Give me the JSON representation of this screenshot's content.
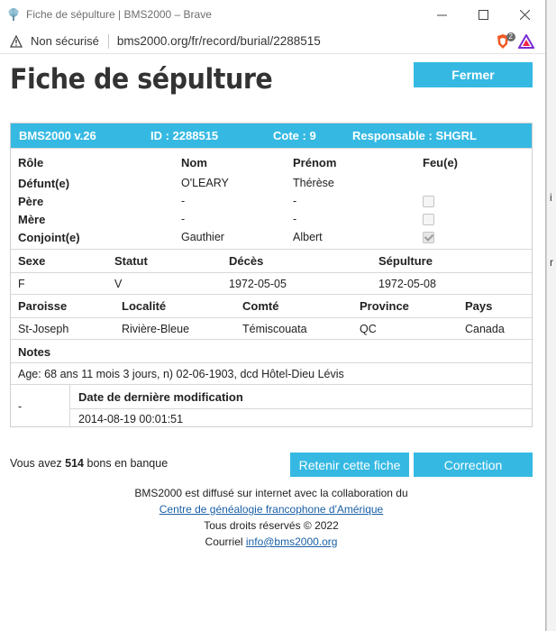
{
  "window": {
    "title": "Fiche de sépulture | BMS2000 – Brave",
    "minimize": "—",
    "maximize": "☐",
    "close": "✕"
  },
  "address": {
    "security": "Non sécurisé",
    "url": "bms2000.org/fr/record/burial/2288515",
    "shield_badge": "2"
  },
  "page": {
    "title": "Fiche de sépulture",
    "close_button": "Fermer"
  },
  "record": {
    "version": "BMS2000 v.26",
    "id": "ID : 2288515",
    "cote": "Cote : 9",
    "responsable": "Responsable : SHGRL",
    "persons_headers": {
      "role": "Rôle",
      "nom": "Nom",
      "prenom": "Prénom",
      "feu": "Feu(e)"
    },
    "persons": [
      {
        "role": "Défunt(e)",
        "nom": "O'LEARY",
        "prenom": "Thérèse",
        "feu": null
      },
      {
        "role": "Père",
        "nom": "-",
        "prenom": "-",
        "feu": false
      },
      {
        "role": "Mère",
        "nom": "-",
        "prenom": "-",
        "feu": false
      },
      {
        "role": "Conjoint(e)",
        "nom": "Gauthier",
        "prenom": "Albert",
        "feu": true
      }
    ],
    "vital_headers": {
      "sexe": "Sexe",
      "statut": "Statut",
      "deces": "Décès",
      "sepulture": "Sépulture"
    },
    "vital": {
      "sexe": "F",
      "statut": "V",
      "deces": "1972-05-05",
      "sepulture": "1972-05-08"
    },
    "place_headers": {
      "paroisse": "Paroisse",
      "localite": "Localité",
      "comte": "Comté",
      "province": "Province",
      "pays": "Pays"
    },
    "place": {
      "paroisse": "St-Joseph",
      "localite": "Rivière-Bleue",
      "comte": "Témiscouata",
      "province": "QC",
      "pays": "Canada"
    },
    "notes_header": "Notes",
    "notes": "Age: 68 ans 11 mois 3 jours, n) 02-06-1903, dcd Hôtel-Dieu Lévis",
    "modif_left": "-",
    "modif_header": "Date de dernière modification",
    "modif_date": "2014-08-19 00:01:51"
  },
  "bank": {
    "prefix": "Vous avez ",
    "count": "514",
    "suffix": " bons en banque"
  },
  "actions": {
    "keep": "Retenir cette fiche",
    "correction": "Correction"
  },
  "footer": {
    "line1": "BMS2000 est diffusé sur internet avec la collaboration du",
    "link": "Centre de généalogie francophone d'Amérique",
    "rights": "Tous droits réservés © 2022",
    "courriel_label": "Courriel ",
    "email": "info@bms2000.org"
  },
  "colors": {
    "accent": "#35b9e3"
  }
}
